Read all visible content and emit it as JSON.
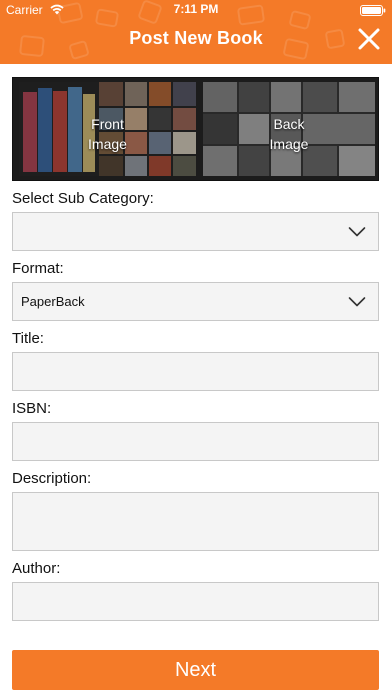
{
  "status_bar": {
    "carrier": "Carrier",
    "time": "7:11 PM"
  },
  "nav": {
    "title": "Post New Book"
  },
  "images": {
    "front_label": "Front\nImage",
    "back_label": "Back\nImage"
  },
  "form": {
    "sub_category": {
      "label": "Select Sub Category:",
      "value": ""
    },
    "format": {
      "label": "Format:",
      "value": "PaperBack"
    },
    "title": {
      "label": "Title:",
      "value": ""
    },
    "isbn": {
      "label": "ISBN:",
      "value": ""
    },
    "description": {
      "label": "Description:",
      "value": ""
    },
    "author": {
      "label": "Author:",
      "value": ""
    }
  },
  "actions": {
    "next_label": "Next"
  },
  "colors": {
    "accent": "#f47a28",
    "field_bg": "#f4f4f4",
    "field_border": "#c8c8c8"
  }
}
